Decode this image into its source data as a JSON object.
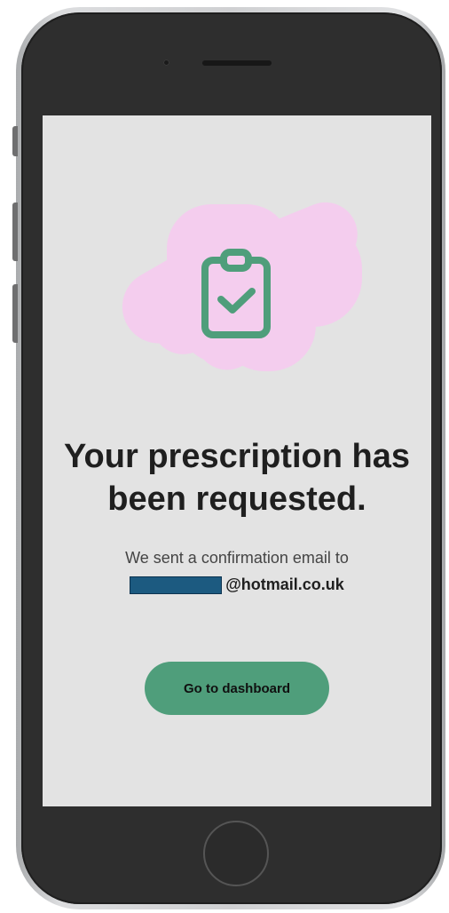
{
  "colors": {
    "screen_background": "#e3e3e3",
    "accent_green": "#4f9e7b",
    "blob_pink": "#f4cdee",
    "icon_green": "#4f9e7b",
    "redaction_blue": "#1c5a80",
    "phone_body": "#2e2e2e"
  },
  "illustration": {
    "icon": "clipboard-check-icon"
  },
  "confirmation": {
    "title_line1": "Your prescription has",
    "title_line2": "been requested.",
    "message": "We sent a confirmation email to",
    "email_domain": "@hotmail.co.uk"
  },
  "actions": {
    "dashboard_label": "Go to dashboard"
  }
}
